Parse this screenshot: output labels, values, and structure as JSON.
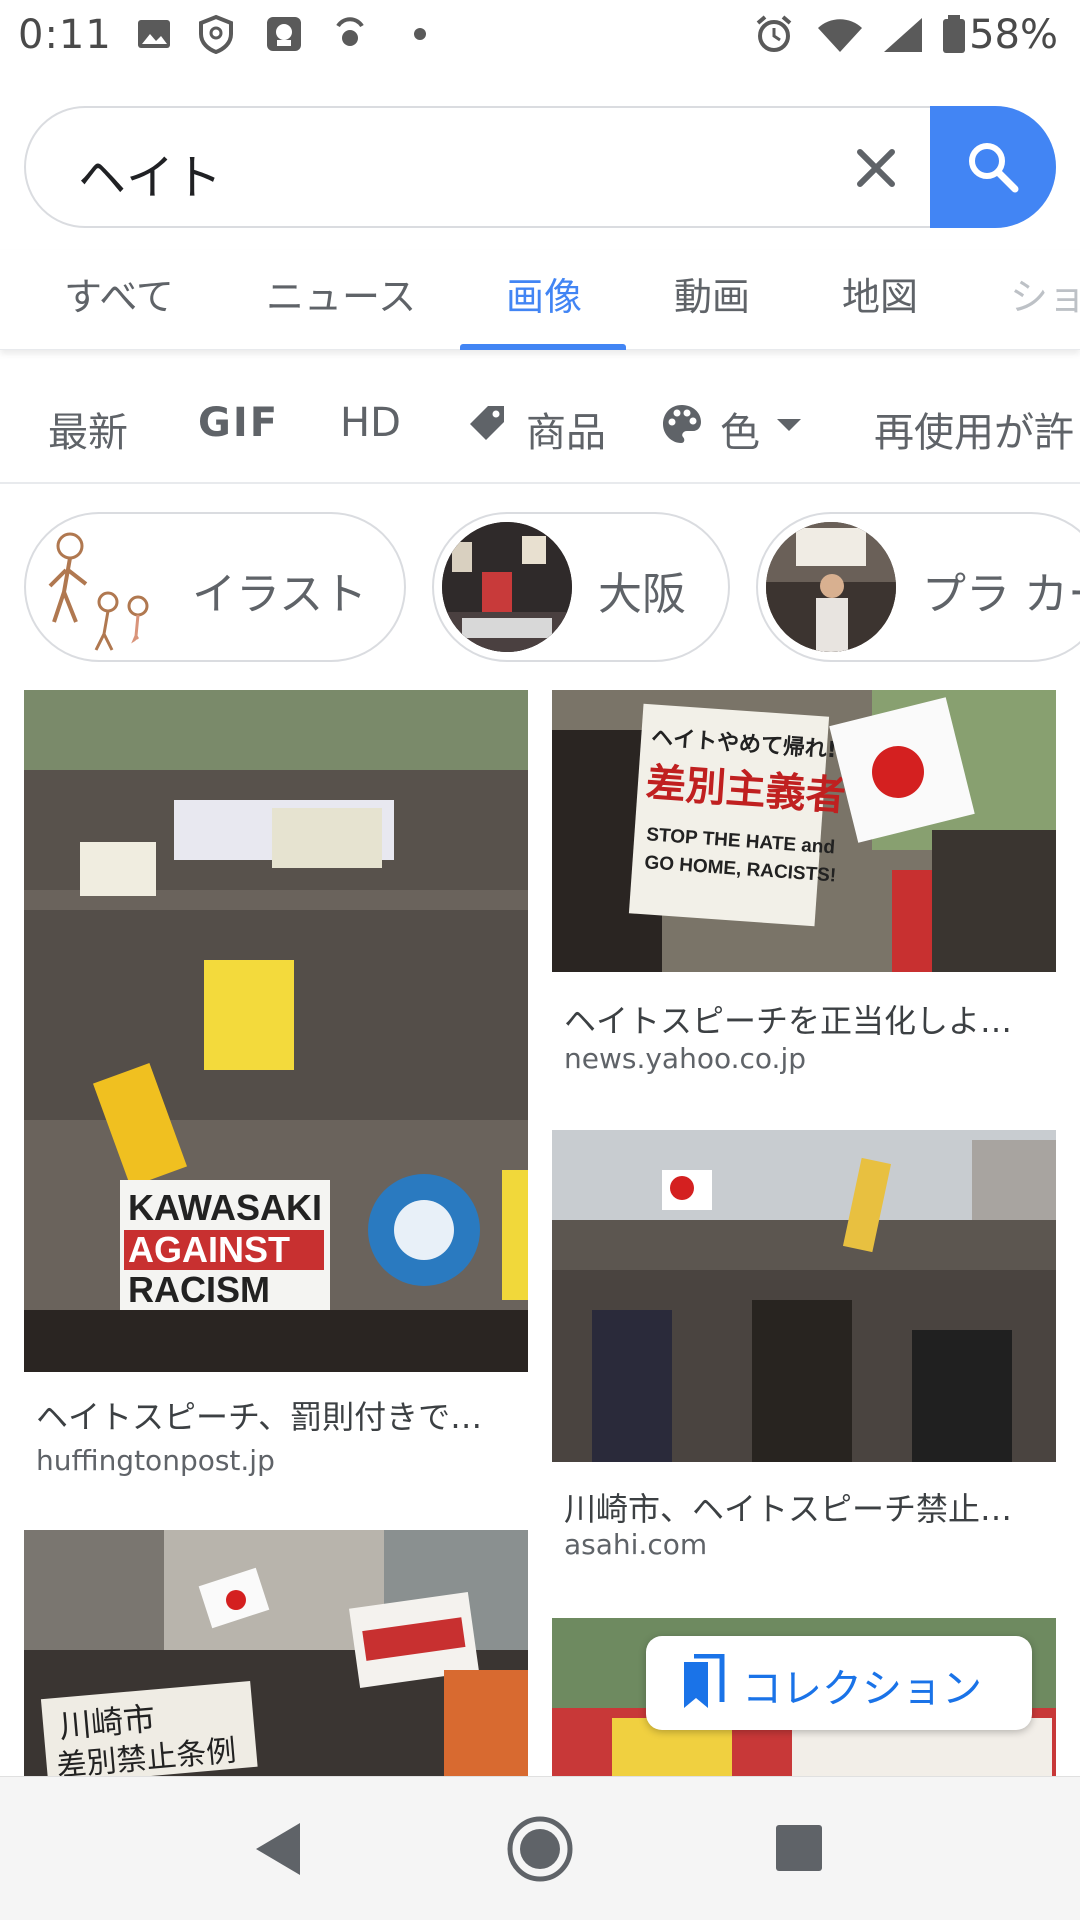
{
  "status_bar": {
    "time": "0:11",
    "battery": "58%"
  },
  "search": {
    "query": "ヘイト"
  },
  "tabs": [
    {
      "label": "すべて"
    },
    {
      "label": "ニュース"
    },
    {
      "label": "画像",
      "active": true
    },
    {
      "label": "動画"
    },
    {
      "label": "地図"
    },
    {
      "label": "ショ"
    }
  ],
  "filters": [
    {
      "label": "最新"
    },
    {
      "label": "GIF"
    },
    {
      "label": "HD"
    },
    {
      "label": "商品",
      "icon": "tag-icon"
    },
    {
      "label": "色",
      "icon": "palette-icon"
    },
    {
      "label": "再使用が許"
    }
  ],
  "chips": [
    {
      "label": "イラスト"
    },
    {
      "label": "大阪"
    },
    {
      "label": "プラ カー"
    }
  ],
  "results": [
    {
      "title": "ヘイトスピーチ、罰則付きで…",
      "source": "huffingtonpost.jp",
      "sign_lines": [
        "KAWASAKI",
        "AGAINST",
        "RACISM"
      ]
    },
    {
      "title": "ヘイトスピーチを正当化しよ…",
      "source": "news.yahoo.co.jp",
      "sign_lines": [
        "ヘイトやめて帰れ!",
        "差別主義者!",
        "STOP THE HATE and",
        "GO HOME, RACISTS!"
      ]
    },
    {
      "title": "川崎市、ヘイトスピーチ禁止…",
      "source": "asahi.com"
    },
    {
      "title": "",
      "source": "",
      "sign_lines": [
        "川崎市",
        "差別禁止条例"
      ]
    },
    {
      "title": "",
      "source": ""
    }
  ],
  "collection": {
    "label": "コレクション"
  },
  "colors": {
    "accent": "#4285f4",
    "text_primary": "#202124",
    "text_secondary": "#5f6368"
  }
}
